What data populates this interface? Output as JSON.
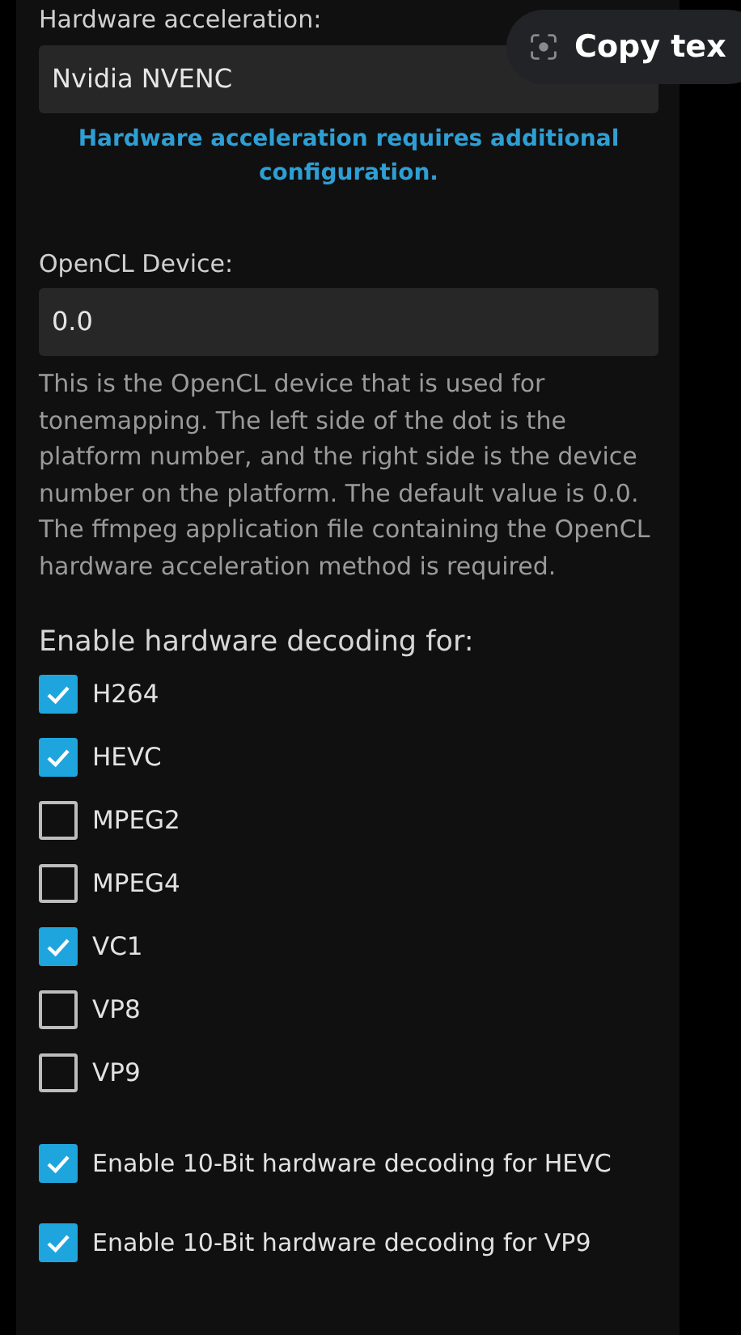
{
  "hardware_acceleration": {
    "label": "Hardware acceleration:",
    "value": "Nvidia NVENC",
    "note": "Hardware acceleration requires additional configuration."
  },
  "opencl_device": {
    "label": "OpenCL Device:",
    "value": "0.0",
    "description": "This is the OpenCL device that is used for tonemapping. The left side of the dot is the platform number, and the right side is the device number on the platform. The default value is 0.0. The ffmpeg application file containing the OpenCL hardware acceleration method is required."
  },
  "decoding": {
    "heading": "Enable hardware decoding for:",
    "codecs": [
      {
        "label": "H264",
        "checked": true
      },
      {
        "label": "HEVC",
        "checked": true
      },
      {
        "label": "MPEG2",
        "checked": false
      },
      {
        "label": "MPEG4",
        "checked": false
      },
      {
        "label": "VC1",
        "checked": true
      },
      {
        "label": "VP8",
        "checked": false
      },
      {
        "label": "VP9",
        "checked": false
      }
    ]
  },
  "ten_bit_options": [
    {
      "label": "Enable 10-Bit hardware decoding for HEVC",
      "checked": true
    },
    {
      "label": "Enable 10-Bit hardware decoding for VP9",
      "checked": true
    }
  ],
  "copy_text_chip": {
    "label": "Copy tex"
  }
}
